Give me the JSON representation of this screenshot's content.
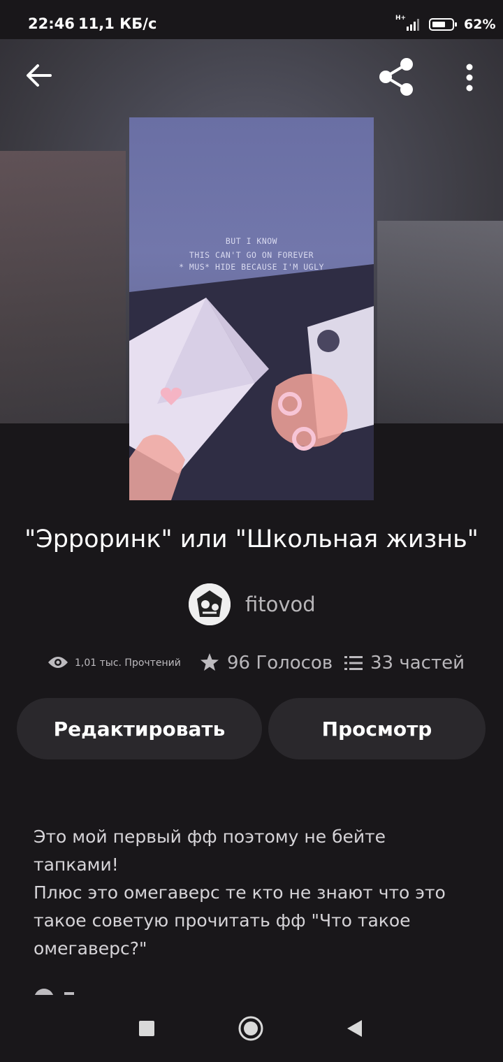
{
  "status_bar": {
    "time": "22:46",
    "speed": "11,1 КБ/с",
    "network": "H+",
    "battery": "62%"
  },
  "header": {
    "back_icon": "arrow-left-icon",
    "share_icon": "share-icon",
    "more_icon": "more-vert-icon"
  },
  "cover": {
    "lines": [
      "BUT I KNOW",
      "THIS CAN'T GO ON FOREVER",
      "* MUS* HIDE BECAUSE I'M UGLY"
    ]
  },
  "story": {
    "title": "\"Эрроринк\" или \"Школьная жизнь\"",
    "author": "fitovod"
  },
  "stats": {
    "reads": "1,01 тыс. Прочтений",
    "votes": "96 Голосов",
    "parts": "33 частей"
  },
  "actions": {
    "edit_label": "Редактировать",
    "view_label": "Просмотр"
  },
  "description": {
    "text": "Это мой первый фф поэтому не бейте\nтапками!\nПлюс это омегаверс те кто не знают что это\nтакое советую прочитать фф  \"Что такое\nомегаверс?\""
  },
  "colors": {
    "background": "#19171a",
    "button": "#2a282c",
    "muted_text": "#b8b6b9"
  }
}
